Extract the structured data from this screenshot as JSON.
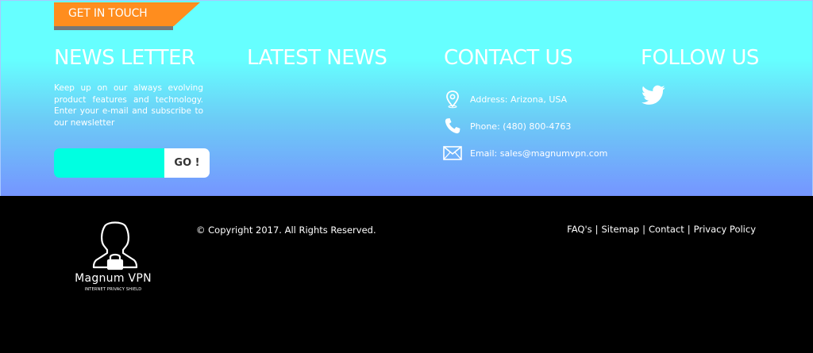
{
  "ribbon": {
    "label": "GET IN TOUCH",
    "color": "#ff8d1e"
  },
  "newsletter": {
    "title": "NEWS LETTER",
    "description": "Keep up on our always evolving product features and technology. Enter your e-mail and subscribe to our newsletter",
    "input_value": "",
    "input_placeholder": "",
    "button_label": "GO !"
  },
  "latest_news": {
    "title": "LATEST NEWS"
  },
  "contact": {
    "title": "CONTACT US",
    "items": [
      {
        "icon": "location-pin-icon",
        "text": "Address: Arizona, USA"
      },
      {
        "icon": "phone-icon",
        "text": "Phone: (480) 800-4763"
      },
      {
        "icon": "envelope-icon",
        "text": "Email: sales@magnumvpn.com"
      }
    ]
  },
  "follow": {
    "title": "FOLLOW US",
    "icons": [
      "twitter-icon"
    ]
  },
  "footer": {
    "logo_name": "Magnum VPN",
    "logo_tagline": "INTERNET PRIVACY SHIELD",
    "copyright": "© Copyright 2017. All Rights Reserved.",
    "links": [
      "FAQ's",
      "Sitemap",
      "Contact",
      "Privacy Policy"
    ],
    "separator": "|"
  },
  "colors": {
    "gradient_top": "#66ffff",
    "gradient_bottom": "#7595ff",
    "input_bg": "#00ffe1",
    "footer_bg": "#000000"
  }
}
